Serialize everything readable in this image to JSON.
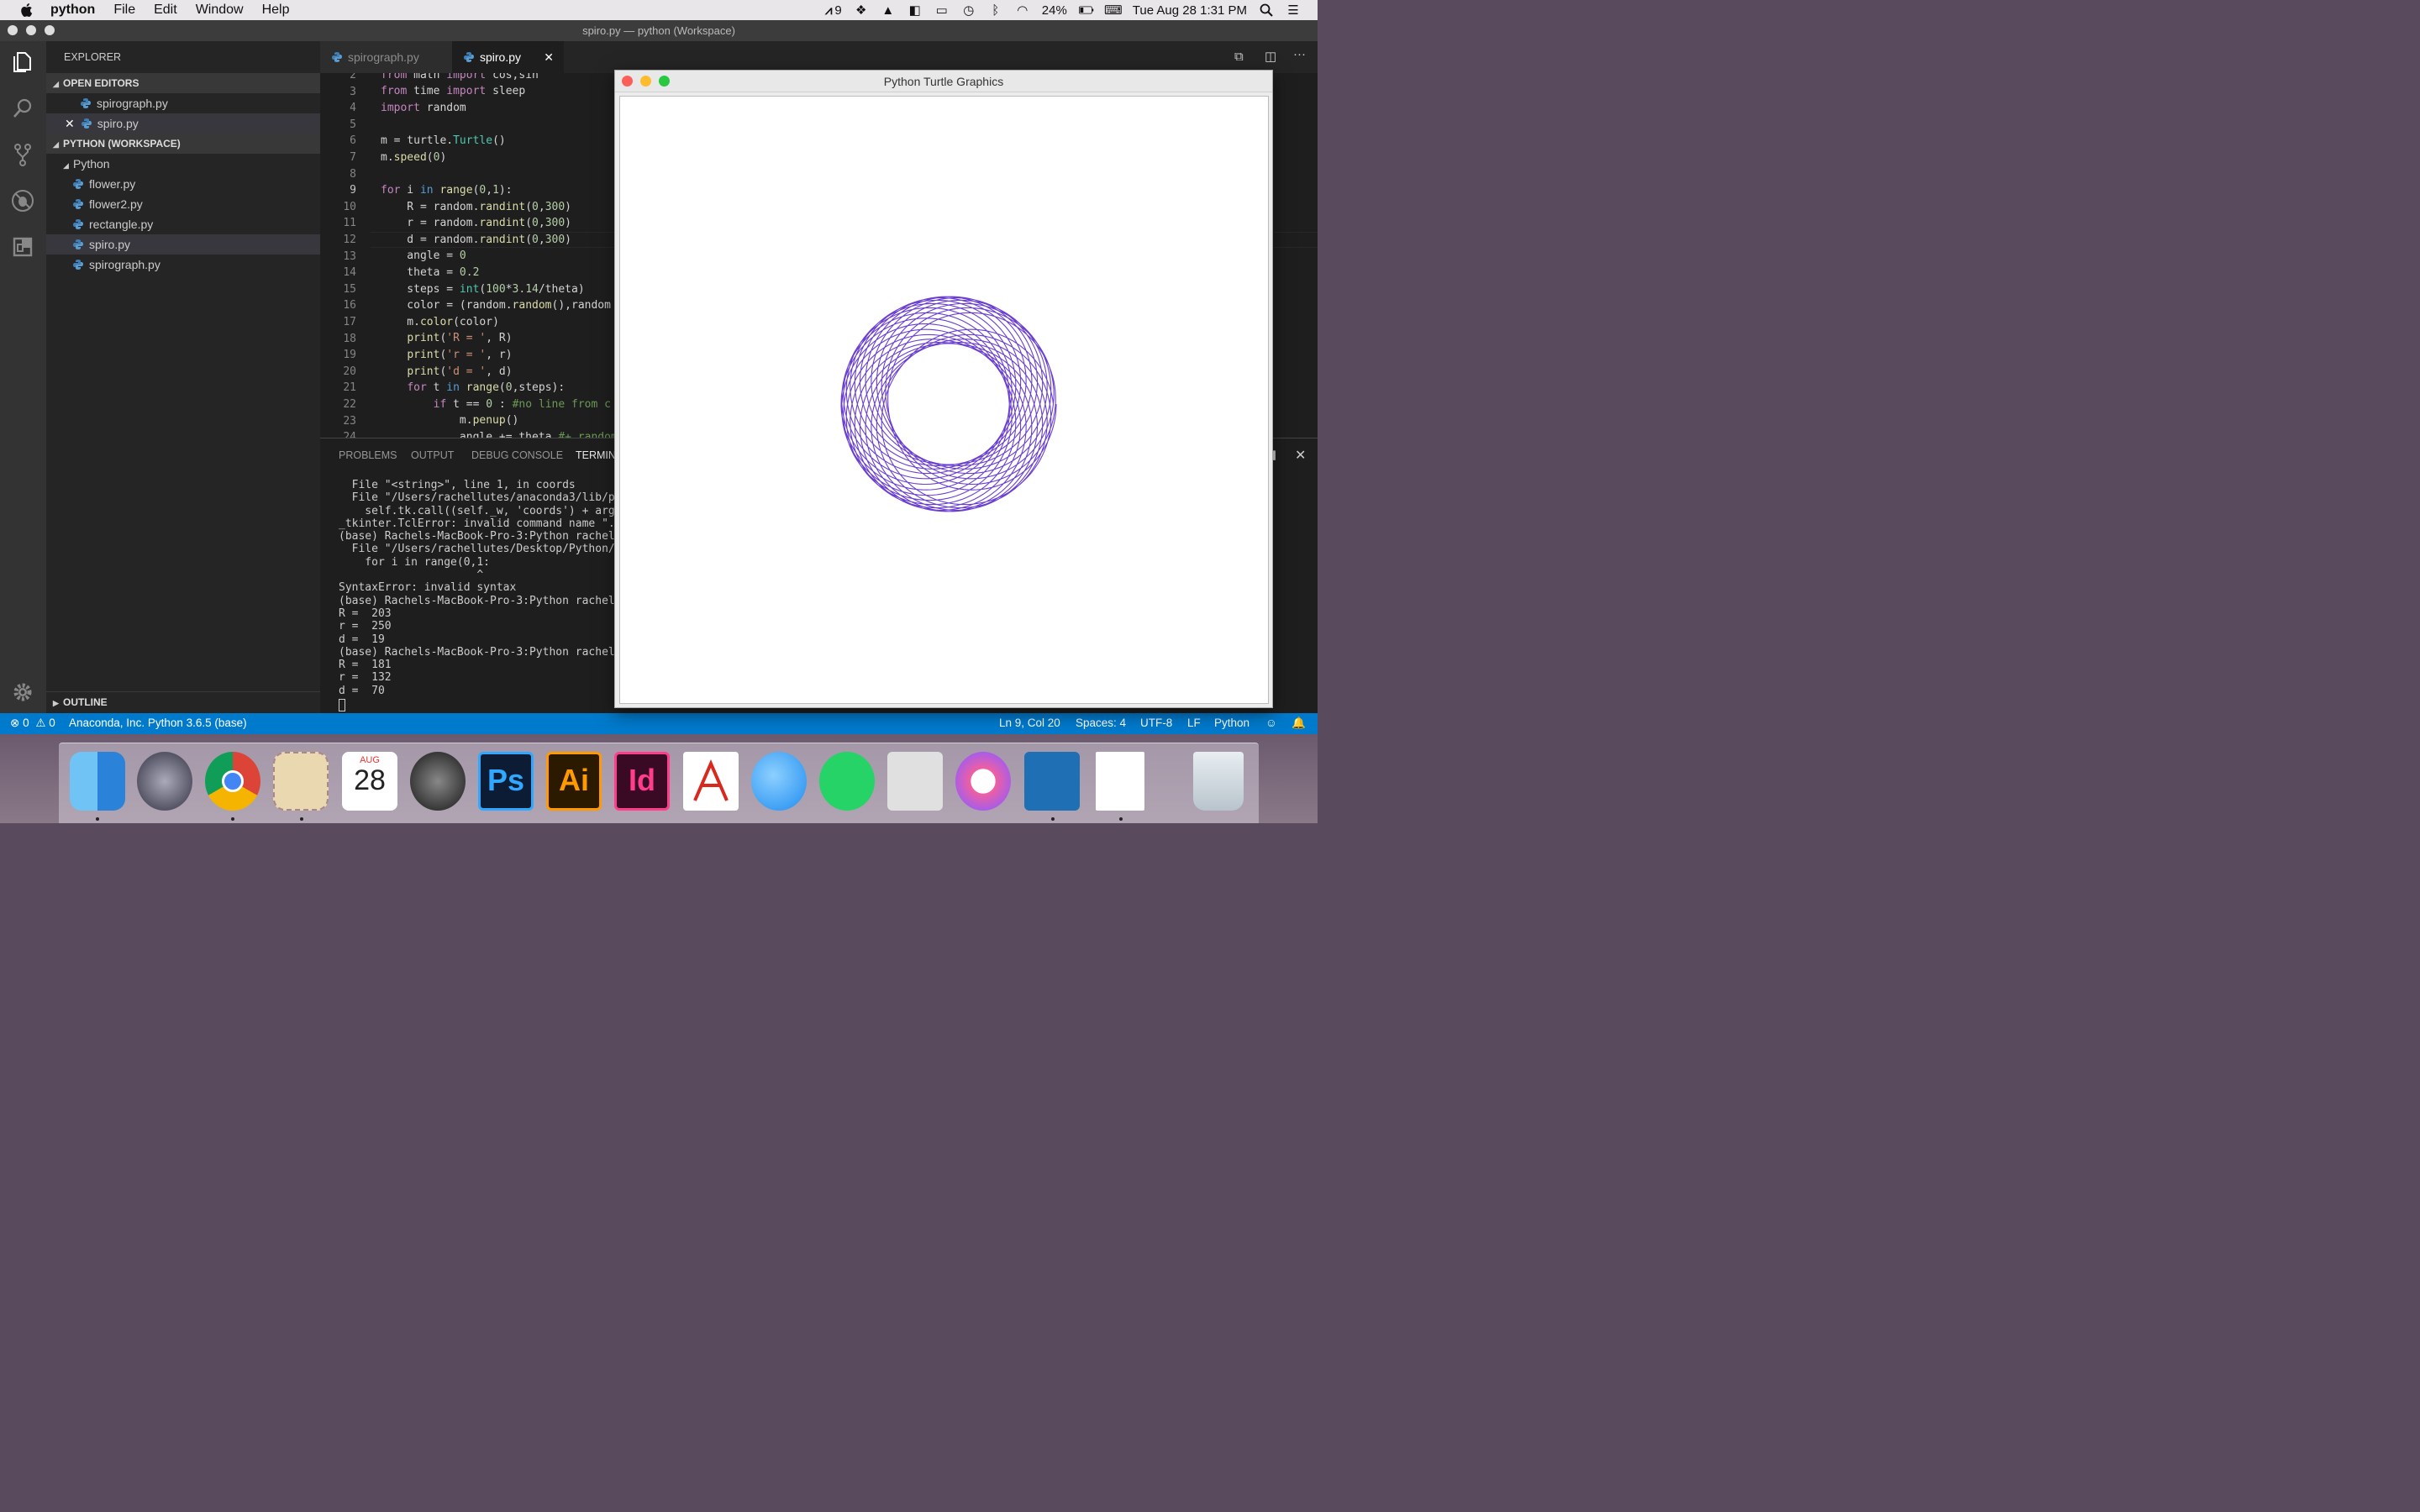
{
  "menubar": {
    "app_name": "python",
    "menus": [
      "File",
      "Edit",
      "Window",
      "Help"
    ],
    "adobe_count": "9",
    "battery": "24%",
    "clock": "Tue Aug 28  1:31 PM"
  },
  "window": {
    "title": "spiro.py — python (Workspace)"
  },
  "sidebar": {
    "header": "EXPLORER",
    "open_editors_label": "OPEN EDITORS",
    "open_editors": [
      "spirograph.py",
      "spiro.py"
    ],
    "workspace_label": "PYTHON (WORKSPACE)",
    "folder": "Python",
    "files": [
      "flower.py",
      "flower2.py",
      "rectangle.py",
      "spiro.py",
      "spirograph.py"
    ],
    "outline_label": "OUTLINE"
  },
  "tabs": [
    "spirograph.py",
    "spiro.py"
  ],
  "editor": {
    "line_numbers": [
      "2",
      "3",
      "4",
      "5",
      "6",
      "7",
      "8",
      "9",
      "10",
      "11",
      "12",
      "13",
      "14",
      "15",
      "16",
      "17",
      "18",
      "19",
      "20",
      "21",
      "22",
      "23",
      "24"
    ]
  },
  "panel": {
    "tabs": [
      "PROBLEMS",
      "OUTPUT",
      "DEBUG CONSOLE",
      "TERMIN"
    ],
    "terminal_lines": [
      "  File \"<string>\", line 1, in coords",
      "  File \"/Users/rachellutes/anaconda3/lib/py",
      "    self.tk.call((self._w, 'coords') + args",
      "_tkinter.TclError: invalid command name \".!",
      "(base) Rachels-MacBook-Pro-3:Python rachell",
      "  File \"/Users/rachellutes/Desktop/Python/s",
      "    for i in range(0,1:",
      "                     ^",
      "SyntaxError: invalid syntax",
      "(base) Rachels-MacBook-Pro-3:Python rachell",
      "R =  203",
      "r =  250",
      "d =  19",
      "(base) Rachels-MacBook-Pro-3:Python rachell",
      "R =  181",
      "r =  132",
      "d =  70"
    ]
  },
  "statusbar": {
    "errors": "0",
    "warnings": "0",
    "interpreter": "Anaconda, Inc. Python 3.6.5 (base)",
    "position": "Ln 9, Col 20",
    "spaces": "Spaces: 4",
    "encoding": "UTF-8",
    "eol": "LF",
    "language": "Python"
  },
  "turtle_window": {
    "title": "Python Turtle Graphics",
    "spiro_color": "#6a3fd0"
  },
  "dock": {
    "calendar_month": "AUG",
    "calendar_day": "28",
    "ps_label": "Ps",
    "ai_label": "Ai",
    "id_label": "Id"
  },
  "colors": {
    "status_blue": "#007acc",
    "editor_bg": "#1e1e1e"
  }
}
